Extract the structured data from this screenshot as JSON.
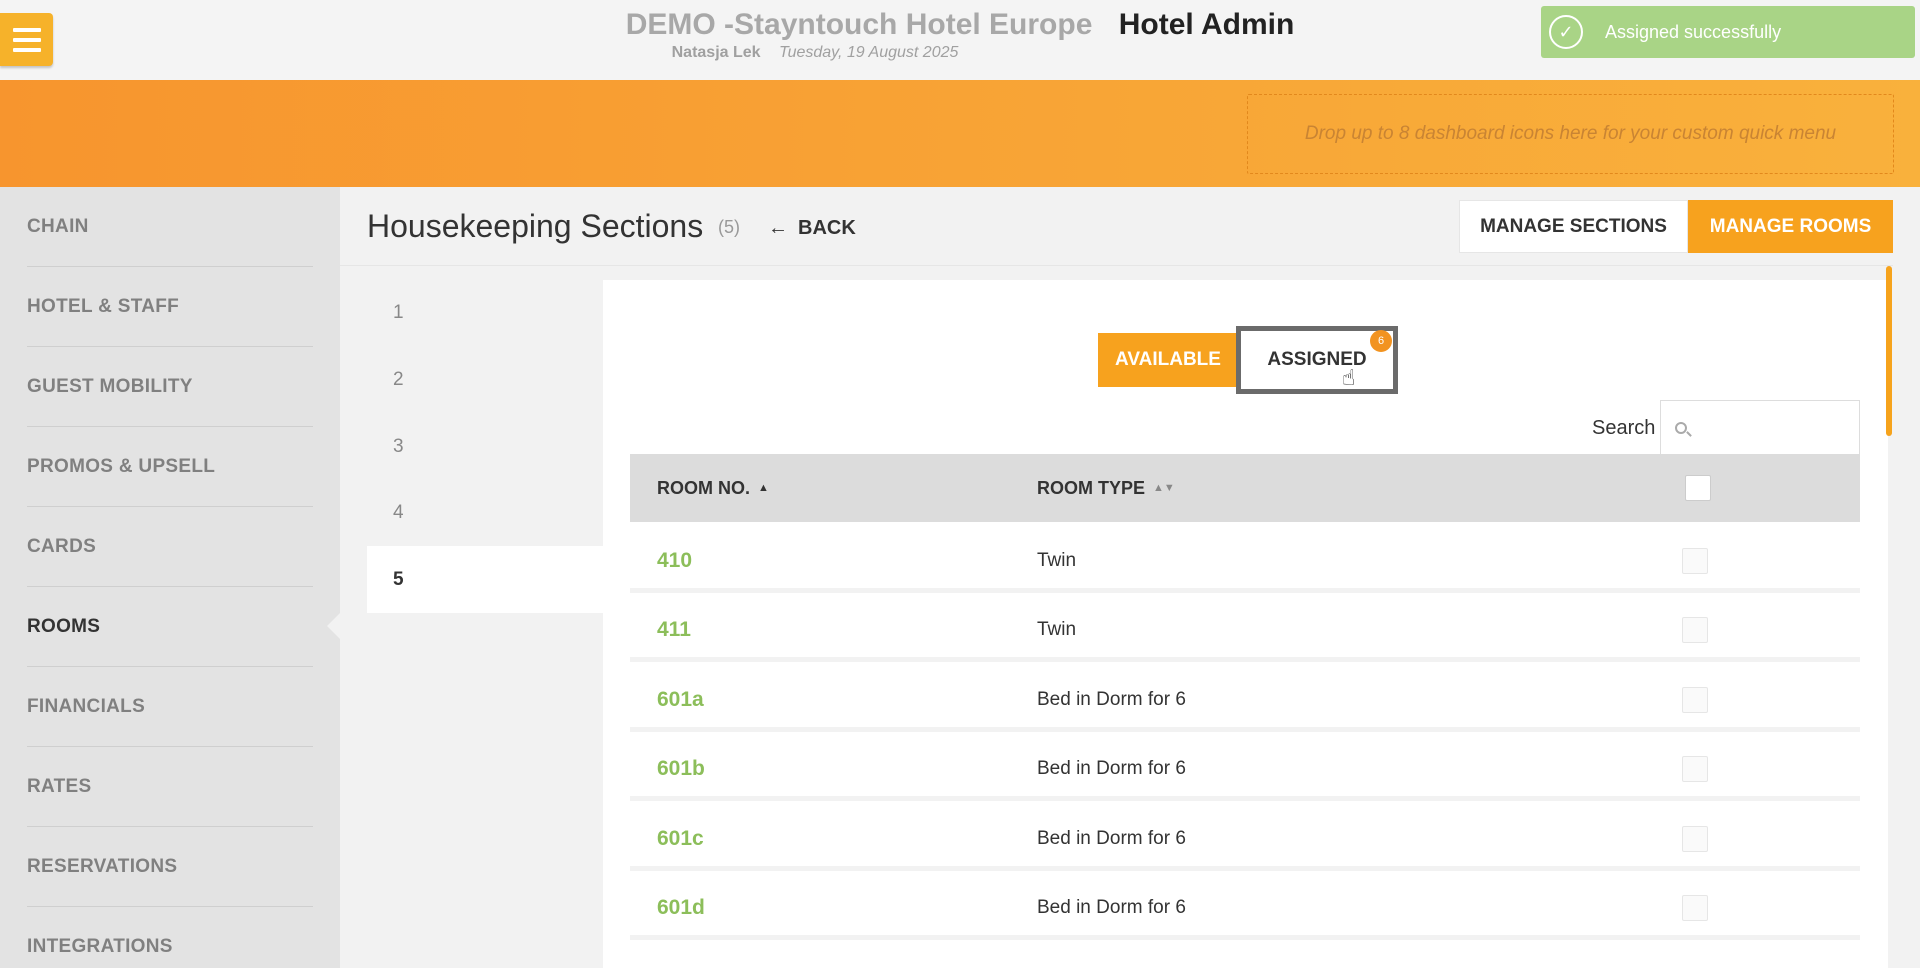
{
  "header": {
    "hotel_name": "DEMO -Stayntouch Hotel Europe",
    "app_name": "Hotel Admin",
    "user": "Natasja Lek",
    "date": "Tuesday, 19 August 2025"
  },
  "toast": {
    "message": "Assigned successfully",
    "icon": "check-circle-icon"
  },
  "quick_menu": {
    "placeholder": "Drop up to 8 dashboard icons here for your custom quick menu"
  },
  "sidebar": {
    "items": [
      {
        "label": "CHAIN"
      },
      {
        "label": "HOTEL & STAFF"
      },
      {
        "label": "GUEST MOBILITY"
      },
      {
        "label": "PROMOS & UPSELL"
      },
      {
        "label": "CARDS"
      },
      {
        "label": "ROOMS",
        "active": true
      },
      {
        "label": "FINANCIALS"
      },
      {
        "label": "RATES"
      },
      {
        "label": "RESERVATIONS"
      },
      {
        "label": "INTEGRATIONS"
      }
    ]
  },
  "page": {
    "title": "Housekeeping Sections",
    "count": "(5)",
    "back_label": "BACK",
    "manage_sections_label": "MANAGE SECTIONS",
    "manage_rooms_label": "MANAGE ROOMS"
  },
  "sections": [
    {
      "label": "1"
    },
    {
      "label": "2"
    },
    {
      "label": "3"
    },
    {
      "label": "4"
    },
    {
      "label": "5",
      "active": true
    }
  ],
  "toggle": {
    "available_label": "AVAILABLE",
    "assigned_label": "ASSIGNED",
    "assigned_count": "6",
    "selected": "assigned"
  },
  "search": {
    "label": "Search",
    "value": "",
    "placeholder": ""
  },
  "table": {
    "columns": {
      "room_no": "ROOM NO.",
      "room_type": "ROOM TYPE"
    },
    "sort_asc_icon": "▲",
    "sort_both_icon": "▲▼",
    "rows": [
      {
        "room": "410",
        "type": "Twin"
      },
      {
        "room": "411",
        "type": "Twin"
      },
      {
        "room": "601a",
        "type": "Bed in Dorm for 6"
      },
      {
        "room": "601b",
        "type": "Bed in Dorm for 6"
      },
      {
        "room": "601c",
        "type": "Bed in Dorm for 6"
      },
      {
        "room": "601d",
        "type": "Bed in Dorm for 6"
      }
    ]
  },
  "colors": {
    "accent": "#f7a21e",
    "room_link": "#8cbe5a",
    "toast_bg": "#a9d486"
  }
}
